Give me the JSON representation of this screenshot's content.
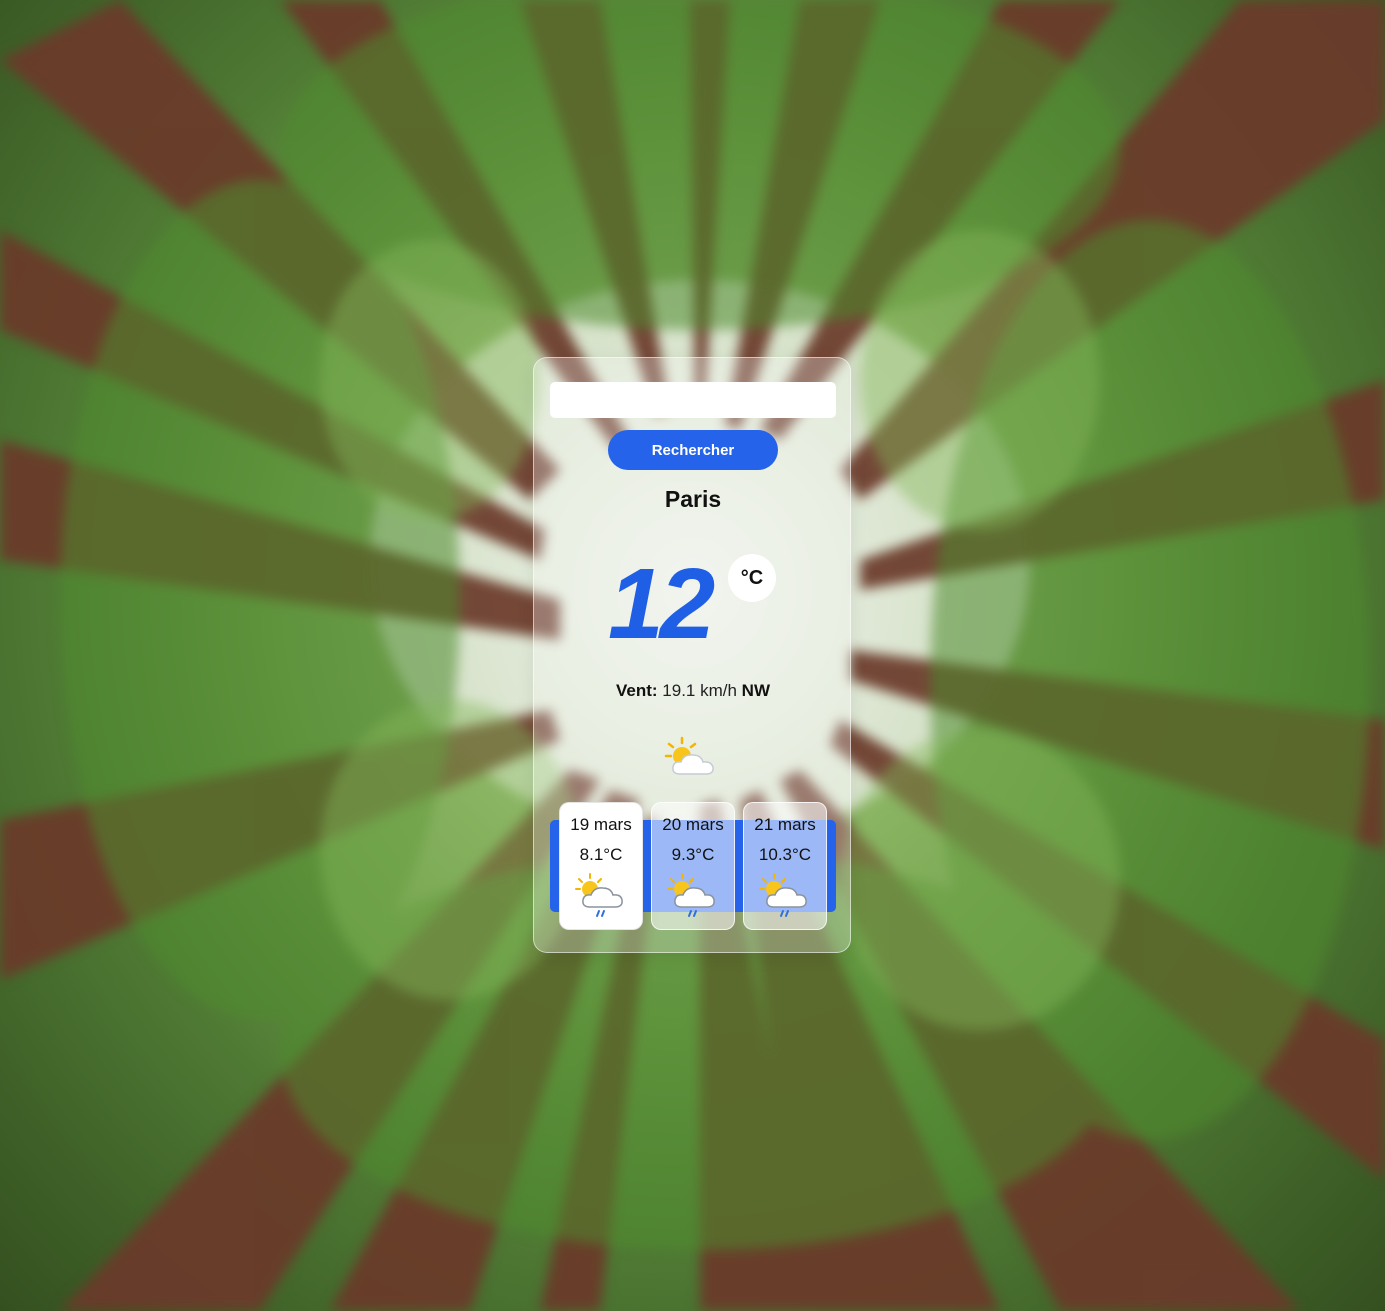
{
  "search": {
    "value": "",
    "placeholder": "",
    "button_label": "Rechercher"
  },
  "current": {
    "city": "Paris",
    "temperature": "12",
    "unit": "°C",
    "wind_label": "Vent:",
    "wind_speed": "19.1 km/h",
    "wind_direction": "NW",
    "icon": "sun-behind-cloud-icon"
  },
  "forecast": [
    {
      "date": "19 mars",
      "temp": "8.1°C",
      "icon": "sun-cloud-rain-icon",
      "selected": true
    },
    {
      "date": "20 mars",
      "temp": "9.3°C",
      "icon": "sun-cloud-rain-icon",
      "selected": false
    },
    {
      "date": "21 mars",
      "temp": "10.3°C",
      "icon": "sun-cloud-rain-icon",
      "selected": false
    }
  ],
  "colors": {
    "accent": "#2563eb",
    "temperature": "#1f5fe6"
  }
}
